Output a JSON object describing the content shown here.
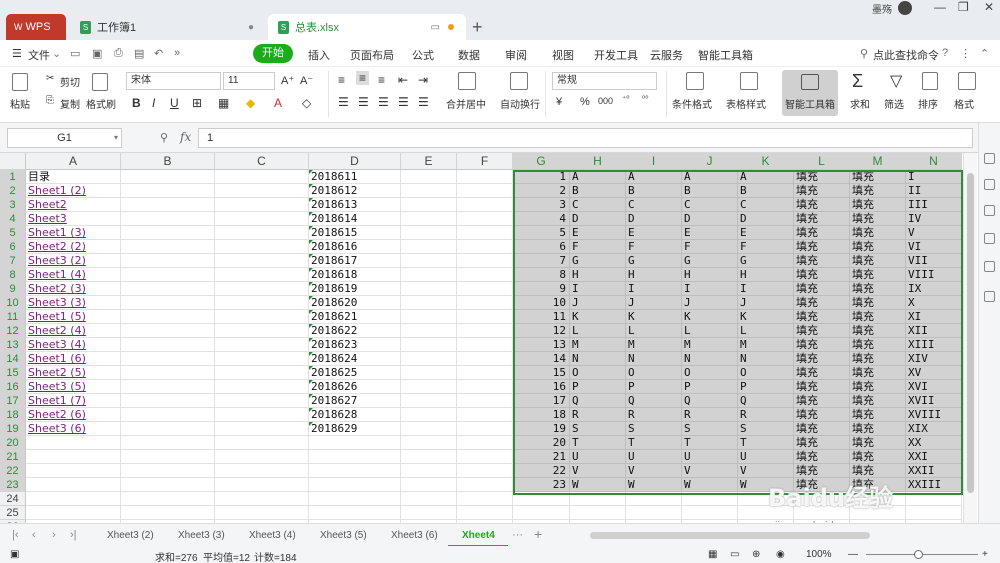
{
  "titlebar": {
    "logo": "WPS",
    "tabs": [
      {
        "label": "工作簿1",
        "icon": "spreadsheet-icon"
      },
      {
        "label": "总表.xlsx",
        "icon": "spreadsheet-icon",
        "active": true
      }
    ],
    "user": "墨殇"
  },
  "menubar": {
    "file_label": "文件",
    "items": [
      "开始",
      "插入",
      "页面布局",
      "公式",
      "数据",
      "审阅",
      "视图",
      "开发工具",
      "云服务",
      "智能工具箱"
    ],
    "search_label": "点此查找命令"
  },
  "ribbon": {
    "paste": "粘贴",
    "cut": "剪切",
    "copy": "复制",
    "format_painter": "格式刷",
    "font_name": "宋体",
    "font_size": "11",
    "merge_center": "合并居中",
    "wrap_text": "自动换行",
    "number_format": "常规",
    "conditional_format": "条件格式",
    "table_style": "表格样式",
    "smart_toolbox": "智能工具箱",
    "sum": "求和",
    "filter": "筛选",
    "sort": "排序",
    "format": "格式",
    "colors": {
      "accent": "#1aad19",
      "brand": "#c0392b"
    }
  },
  "formula_bar": {
    "name_box": "G1",
    "fx": "fx",
    "value": "1"
  },
  "grid": {
    "columns": [
      "A",
      "B",
      "C",
      "D",
      "E",
      "F",
      "G",
      "H",
      "I",
      "J",
      "K",
      "L",
      "M",
      "N"
    ],
    "rows": [
      "1",
      "2",
      "3",
      "4",
      "5",
      "6",
      "7",
      "8",
      "9",
      "10",
      "11",
      "12",
      "13",
      "14",
      "15",
      "16",
      "17",
      "18",
      "19",
      "20",
      "21",
      "22",
      "23",
      "24",
      "25",
      "26"
    ],
    "col_a": [
      "目录",
      "Sheet1 (2)",
      "Sheet2",
      "Sheet3",
      "Sheet1 (3)",
      "Sheet2 (2)",
      "Sheet3 (2)",
      "Sheet1 (4)",
      "Sheet2 (3)",
      "Sheet3 (3)",
      "Sheet1 (5)",
      "Sheet2 (4)",
      "Sheet3 (4)",
      "Sheet1 (6)",
      "Sheet2 (5)",
      "Sheet3 (5)",
      "Sheet1 (7)",
      "Sheet2 (6)",
      "Sheet3 (6)"
    ],
    "col_d": [
      "2018611",
      "2018612",
      "2018613",
      "2018614",
      "2018615",
      "2018616",
      "2018617",
      "2018618",
      "2018619",
      "2018620",
      "2018621",
      "2018622",
      "2018623",
      "2018624",
      "2018625",
      "2018626",
      "2018627",
      "2018628",
      "2018629"
    ],
    "col_g": [
      "1",
      "2",
      "3",
      "4",
      "5",
      "6",
      "7",
      "8",
      "9",
      "10",
      "11",
      "12",
      "13",
      "14",
      "15",
      "16",
      "17",
      "18",
      "19",
      "20",
      "21",
      "22",
      "23"
    ],
    "col_h": [
      "A",
      "B",
      "C",
      "D",
      "E",
      "F",
      "G",
      "H",
      "I",
      "J",
      "K",
      "L",
      "M",
      "N",
      "O",
      "P",
      "Q",
      "R",
      "S",
      "T",
      "U",
      "V",
      "W"
    ],
    "col_i": [
      "A",
      "B",
      "C",
      "D",
      "E",
      "F",
      "G",
      "H",
      "I",
      "J",
      "K",
      "L",
      "M",
      "N",
      "O",
      "P",
      "Q",
      "R",
      "S",
      "T",
      "U",
      "V",
      "W"
    ],
    "col_j": [
      "A",
      "B",
      "C",
      "D",
      "E",
      "F",
      "G",
      "H",
      "I",
      "J",
      "K",
      "L",
      "M",
      "N",
      "O",
      "P",
      "Q",
      "R",
      "S",
      "T",
      "U",
      "V",
      "W"
    ],
    "col_k": [
      "A",
      "B",
      "C",
      "D",
      "E",
      "F",
      "G",
      "H",
      "I",
      "J",
      "K",
      "L",
      "M",
      "N",
      "O",
      "P",
      "Q",
      "R",
      "S",
      "T",
      "U",
      "V",
      "W"
    ],
    "col_l": [
      "填充",
      "填充",
      "填充",
      "填充",
      "填充",
      "填充",
      "填充",
      "填充",
      "填充",
      "填充",
      "填充",
      "填充",
      "填充",
      "填充",
      "填充",
      "填充",
      "填充",
      "填充",
      "填充",
      "填充",
      "填充",
      "填充",
      "填充"
    ],
    "col_m": [
      "填充",
      "填充",
      "填充",
      "填充",
      "填充",
      "填充",
      "填充",
      "填充",
      "填充",
      "填充",
      "填充",
      "填充",
      "填充",
      "填充",
      "填充",
      "填充",
      "填充",
      "填充",
      "填充",
      "填充",
      "填充",
      "填充",
      "填充"
    ],
    "col_n": [
      "I",
      "II",
      "III",
      "IV",
      "V",
      "VI",
      "VII",
      "VIII",
      "IX",
      "X",
      "XI",
      "XII",
      "XIII",
      "XIV",
      "XV",
      "XVI",
      "XVII",
      "XVIII",
      "XIX",
      "XX",
      "XXI",
      "XXII",
      "XXIII"
    ]
  },
  "sheet_tabs": [
    "Xheet3 (2)",
    "Xheet3 (3)",
    "Xheet3 (4)",
    "Xheet3 (5)",
    "Xheet3 (6)",
    "Xheet4"
  ],
  "status": {
    "sum": "求和=276",
    "average": "平均值=12",
    "count": "计数=184",
    "zoom": "100%"
  },
  "watermark": {
    "text": "Baidu经验",
    "url": "jingyan.baidu.com"
  }
}
